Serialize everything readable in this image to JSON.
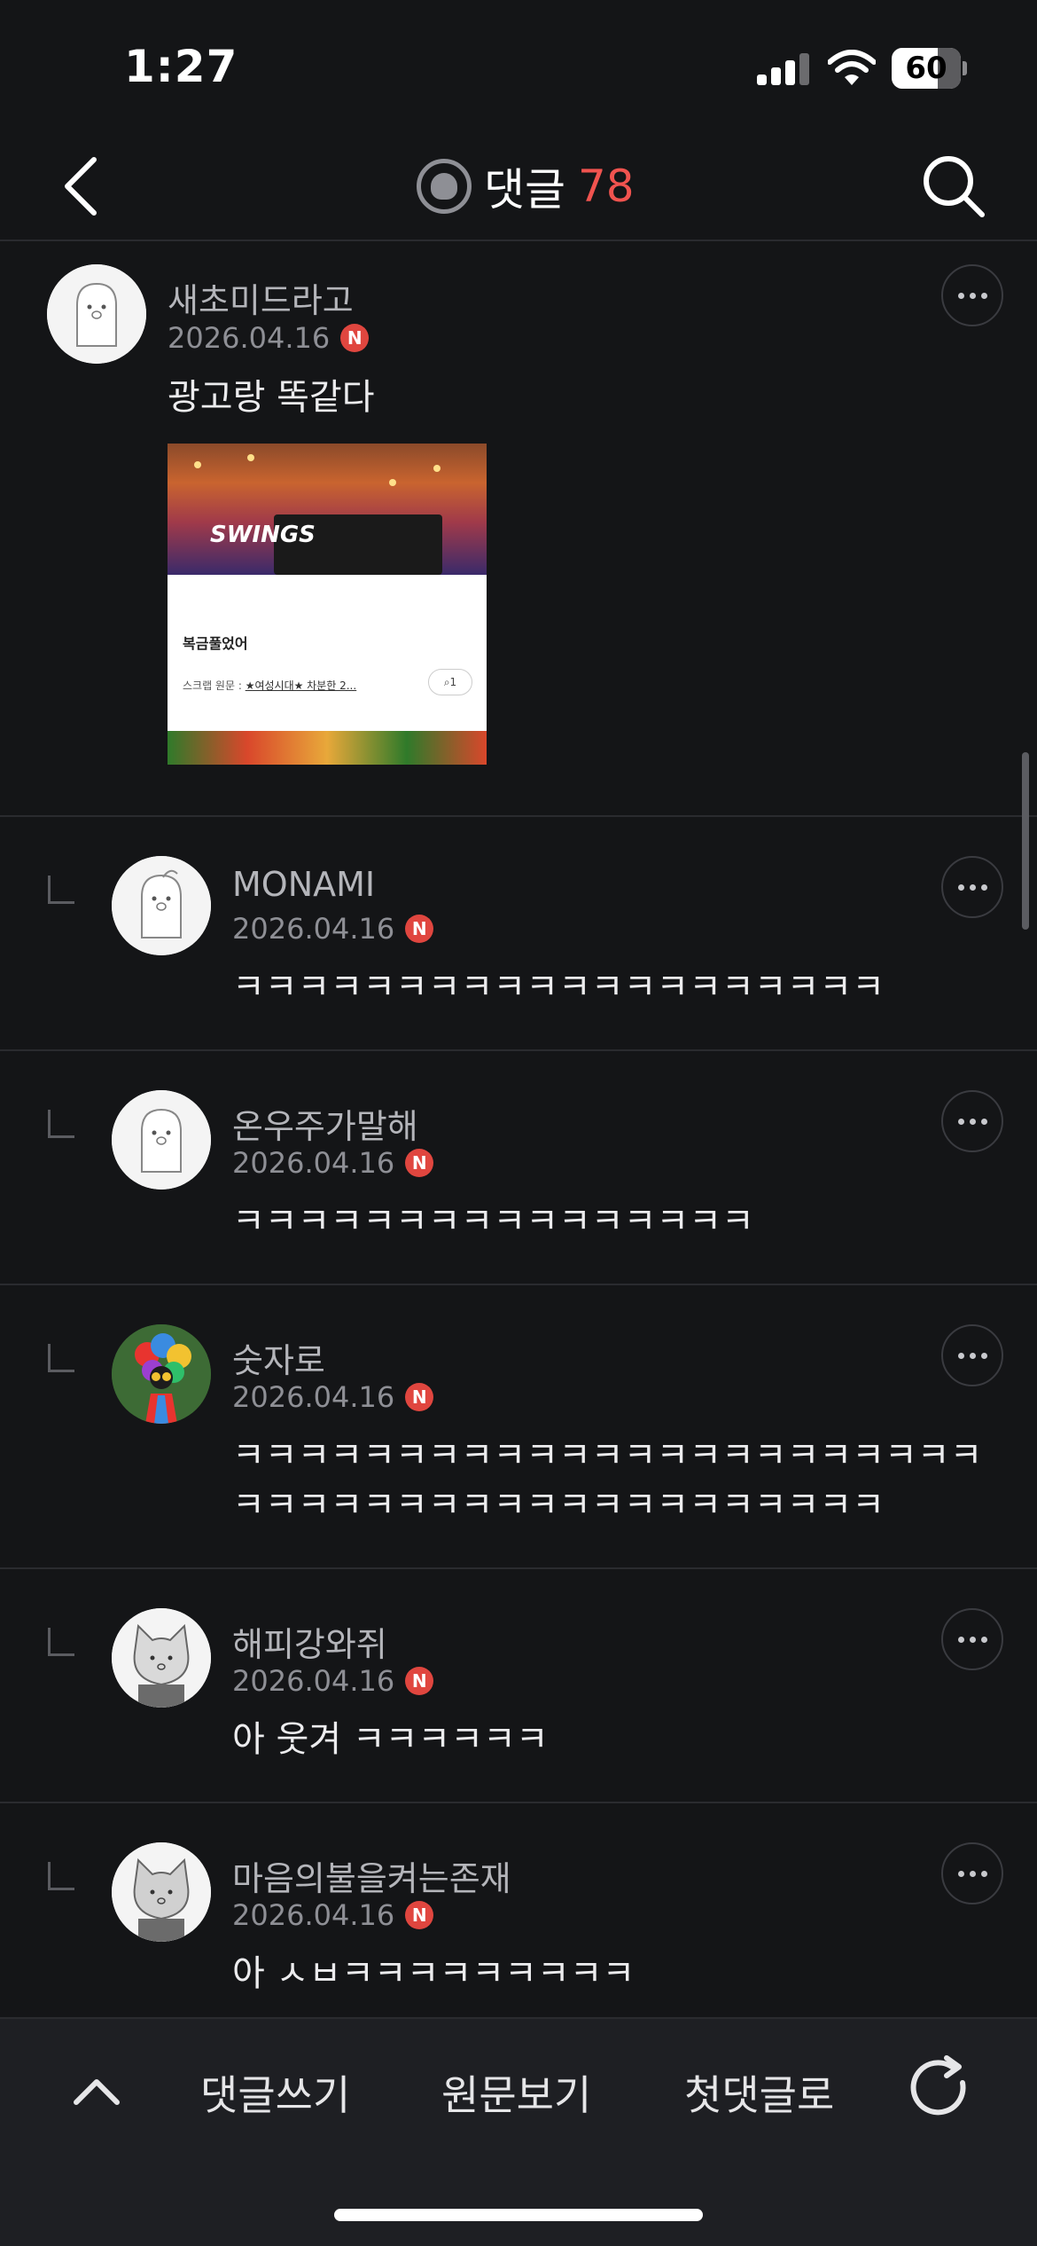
{
  "status_bar": {
    "time": "1:27",
    "battery": "60"
  },
  "header": {
    "title": "댓글",
    "count": "78"
  },
  "comments": [
    {
      "nickname": "새초미드라고",
      "date": "2026.04.16",
      "badge": "N",
      "text": "광고랑 똑같다",
      "attachment": {
        "watermark": "SWINGS",
        "title": "복금풀었어",
        "scrap_prefix": "스크랩 원문 : ",
        "scrap_link": "★여성시대★ 차분한 2...",
        "clip_count": "1"
      }
    },
    {
      "nickname": "MONAMI",
      "date": "2026.04.16",
      "badge": "N",
      "text": "ㅋㅋㅋㅋㅋㅋㅋㅋㅋㅋㅋㅋㅋㅋㅋㅋㅋㅋㅋㅋ"
    },
    {
      "nickname": "온우주가말해",
      "date": "2026.04.16",
      "badge": "N",
      "text": "ㅋㅋㅋㅋㅋㅋㅋㅋㅋㅋㅋㅋㅋㅋㅋㅋ"
    },
    {
      "nickname": "숫자로",
      "date": "2026.04.16",
      "badge": "N",
      "text": "ㅋㅋㅋㅋㅋㅋㅋㅋㅋㅋㅋㅋㅋㅋㅋㅋㅋㅋㅋㅋㅋㅋㅋ",
      "text2": "ㅋㅋㅋㅋㅋㅋㅋㅋㅋㅋㅋㅋㅋㅋㅋㅋㅋㅋㅋㅋ"
    },
    {
      "nickname": "해피강와쥐",
      "date": "2026.04.16",
      "badge": "N",
      "text": "아 웃겨 ㅋㅋㅋㅋㅋㅋ"
    },
    {
      "nickname": "마음의불을켜는존재",
      "date": "2026.04.16",
      "badge": "N",
      "text": "아 ㅅㅂㅋㅋㅋㅋㅋㅋㅋㅋㅋ"
    }
  ],
  "bottom_bar": {
    "write_label": "댓글쓰기",
    "original_label": "원문보기",
    "first_label": "첫댓글로"
  }
}
